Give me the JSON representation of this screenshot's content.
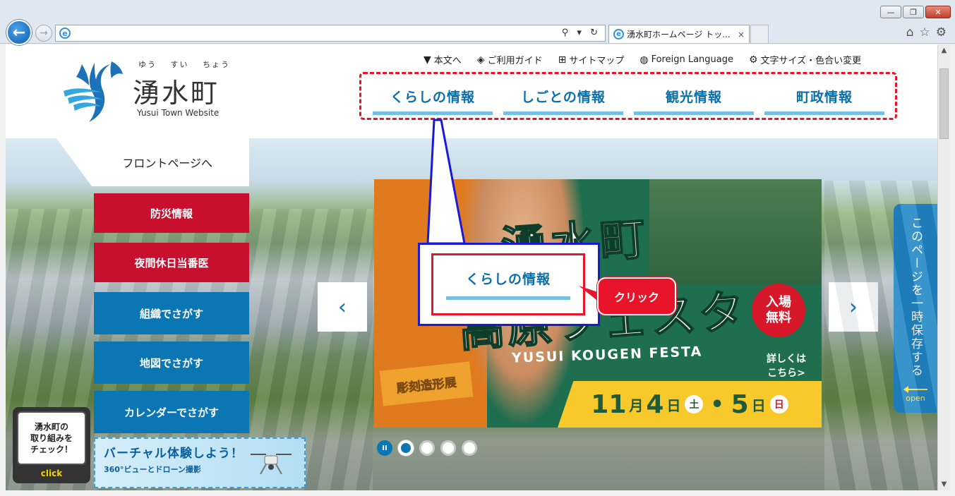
{
  "browser": {
    "tab_title": "湧水町ホームページ トッ...",
    "tab_close": "×",
    "address_tools": "⚲ ▾ ↻",
    "win_minimize": "—",
    "win_maximize": "❐",
    "win_close": "✕"
  },
  "logo": {
    "ruby": "ゆう すい ちょう",
    "title": "湧水町",
    "subtitle": "Yusui Town Website"
  },
  "utility_nav": [
    {
      "label": "本文へ",
      "icon": "down-arrow-icon"
    },
    {
      "label": "ご利用ガイド",
      "icon": "guide-icon"
    },
    {
      "label": "サイトマップ",
      "icon": "sitemap-icon"
    },
    {
      "label": "Foreign Language",
      "icon": "globe-icon"
    },
    {
      "label": "文字サイズ・色合い変更",
      "icon": "settings-icon"
    }
  ],
  "main_nav": [
    "くらしの情報",
    "しごとの情報",
    "観光情報",
    "町政情報"
  ],
  "front_page": "フロントページへ",
  "side_menu": {
    "disaster": "防災情報",
    "night_doctor": "夜間休日当番医",
    "org_search": "組織でさがす",
    "map_search": "地図でさがす",
    "calendar_search": "カレンダーでさがす"
  },
  "vr_banner": {
    "title": "バーチャル体験しよう！",
    "sub": "360°ビューとドローン撮影"
  },
  "check_box": {
    "text": "湧水町の\n取り組みを\nチェック！",
    "click": "click"
  },
  "slide": {
    "title_top": "湧水町",
    "title_bottom": "高原フェスタ",
    "sub": "YUSUI KOUGEN FESTA",
    "badge": "入場\n無料",
    "detail": "詳しくは\nこちら>",
    "tag": "彫刻造形展",
    "date1_num": "11",
    "date1_month": "月",
    "date1_day": "4",
    "date_unit": "日",
    "day1": "土",
    "date_sep": "•",
    "date2_day": "5",
    "day2": "日"
  },
  "carousel": {
    "prev": "‹",
    "next": "›",
    "pause": "II"
  },
  "save_tab": {
    "text": "このページを一時保存する",
    "open": "open"
  },
  "callout": {
    "label": "くらしの情報",
    "click": "クリック"
  },
  "colors": {
    "nav_blue": "#0b6fa8",
    "nav_underline": "#74c0e6",
    "red_button": "#c8102e",
    "blue_button": "#0b76b4",
    "highlight_red": "#e8152a",
    "callout_blue": "#1a1ad6"
  }
}
